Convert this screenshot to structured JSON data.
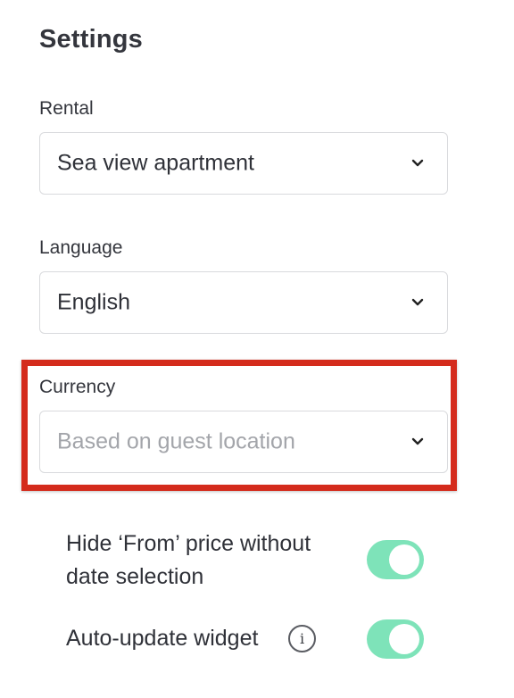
{
  "page": {
    "title": "Settings"
  },
  "rental": {
    "label": "Rental",
    "value": "Sea view apartment"
  },
  "language": {
    "label": "Language",
    "value": "English"
  },
  "currency": {
    "label": "Currency",
    "placeholder": "Based on guest location"
  },
  "toggles": [
    {
      "label_line1": "Hide ‘From’ price without",
      "label_line2": "date selection",
      "enabled": true
    },
    {
      "label": "Auto-update widget",
      "info_icon": "i",
      "enabled": true
    }
  ],
  "colors": {
    "toggle_on": "#7ee3b9",
    "highlight": "#d42b1c"
  },
  "icons": {
    "select_chevron": "chevron-down-icon",
    "info": "info-circle-icon"
  }
}
